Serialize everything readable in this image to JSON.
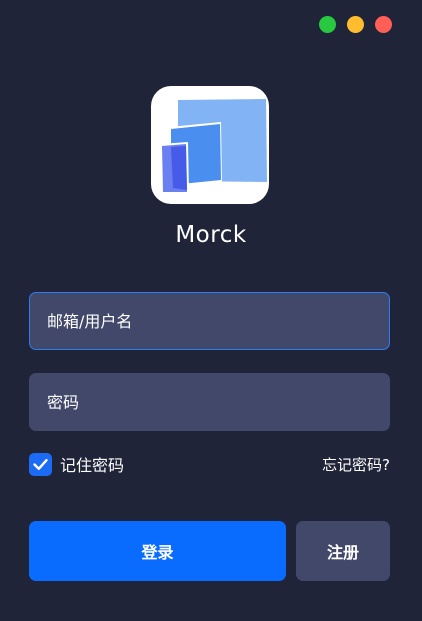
{
  "window": {
    "controls": [
      {
        "name": "maximize",
        "color": "#28c840"
      },
      {
        "name": "minimize",
        "color": "#febc2e"
      },
      {
        "name": "close",
        "color": "#ff5f57"
      }
    ]
  },
  "app": {
    "name": "Morck",
    "logo_icon": "stacked-windows-icon"
  },
  "form": {
    "username_placeholder": "邮箱/用户名",
    "username_value": "",
    "password_placeholder": "密码",
    "password_value": "",
    "remember_label": "记住密码",
    "remember_checked": true,
    "forgot_label": "忘记密码?"
  },
  "buttons": {
    "login_label": "登录",
    "register_label": "注册"
  },
  "colors": {
    "background": "#1f2438",
    "field_background": "#41486a",
    "field_focus_border": "#2c7df2",
    "accent": "#0a6cff",
    "checkbox": "#1b6bf5"
  }
}
